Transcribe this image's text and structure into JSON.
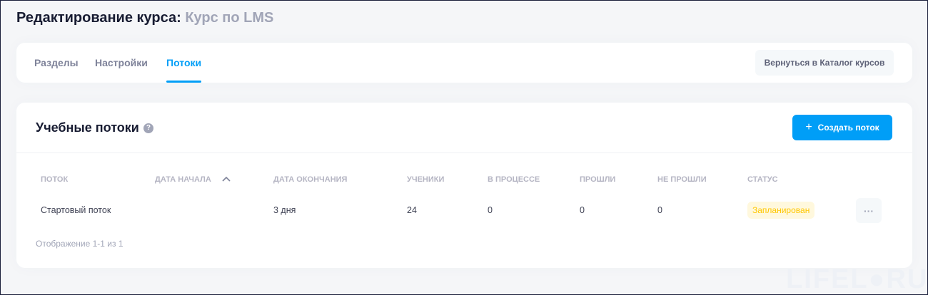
{
  "page": {
    "title": "Редактирование курса:",
    "course": "Курс по LMS"
  },
  "tabs": [
    {
      "label": "Разделы"
    },
    {
      "label": "Настройки"
    },
    {
      "label": "Потоки",
      "active": true
    }
  ],
  "back_button": "Вернуться в Каталог курсов",
  "section": {
    "title": "Учебные потоки",
    "help": "?",
    "create_button": "Создать поток",
    "create_icon": "+"
  },
  "table": {
    "columns": [
      "Поток",
      "Дата начала",
      "Дата окончания",
      "Ученики",
      "В процессе",
      "Прошли",
      "Не прошли",
      "Статус"
    ],
    "sort_icon": "chevron-up",
    "rows": [
      {
        "name": "Стартовый поток",
        "start": "",
        "end": "3 дня",
        "students": "24",
        "in_progress": "0",
        "passed": "0",
        "failed": "0",
        "status": "Запланирован",
        "actions": "···"
      }
    ]
  },
  "footer": "Отображение 1-1 из 1",
  "watermark": "LIFEL RU",
  "colors": {
    "accent": "#009ef7",
    "status_bg": "#fff8dd",
    "status_text": "#ffc700"
  }
}
